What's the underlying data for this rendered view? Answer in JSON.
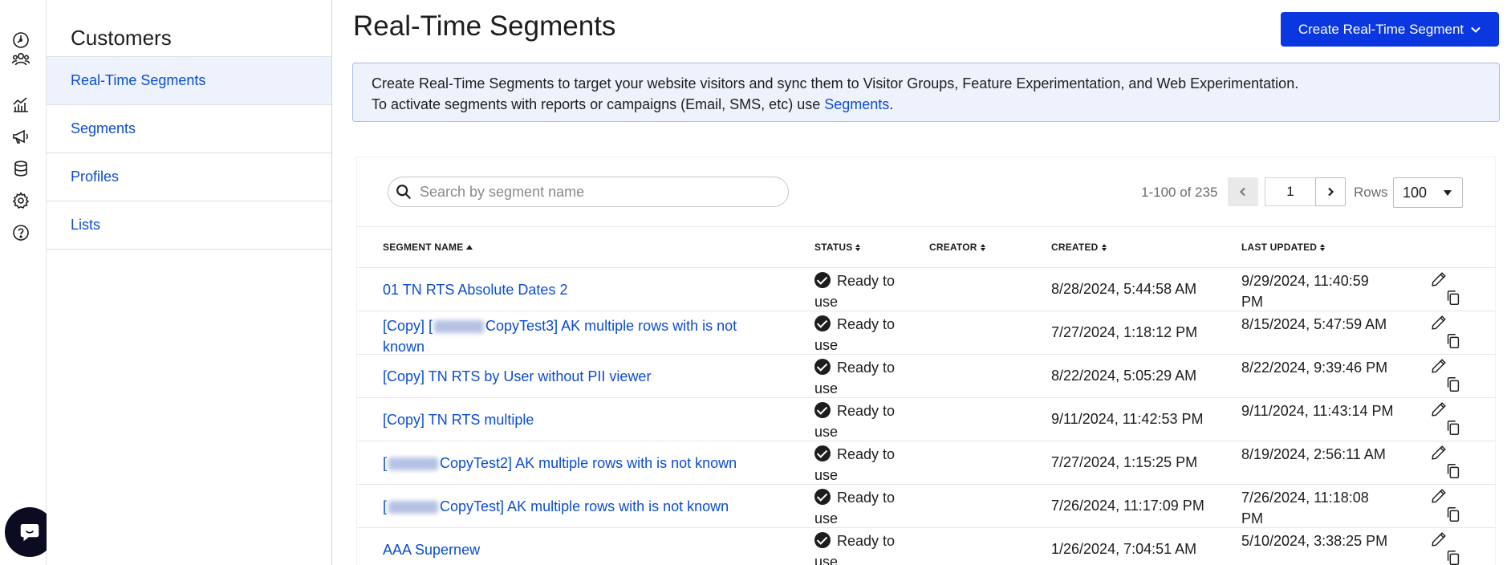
{
  "rail": {
    "icons": [
      "dashboard-icon",
      "customers-icon",
      "analytics-icon",
      "campaigns-icon",
      "data-icon",
      "settings-icon",
      "help-icon"
    ]
  },
  "sidebar": {
    "title": "Customers",
    "items": [
      {
        "label": "Real-Time Segments",
        "active": true
      },
      {
        "label": "Segments",
        "active": false
      },
      {
        "label": "Profiles",
        "active": false
      },
      {
        "label": "Lists",
        "active": false
      }
    ]
  },
  "header": {
    "title": "Real-Time Segments",
    "create_label": "Create Real-Time Segment",
    "accent": "#0a37e0"
  },
  "info": {
    "line1": "Create Real-Time Segments to target your website visitors and sync them to Visitor Groups, Feature Experimentation, and Web Experimentation.",
    "line2_prefix": "To activate segments with reports or campaigns (Email, SMS, etc) use ",
    "line2_link": "Segments",
    "line2_suffix": "."
  },
  "search": {
    "placeholder": "Search by segment name"
  },
  "pagination": {
    "range": "1-100 of 235",
    "page": "1",
    "rows_label": "Rows",
    "rows_value": "100"
  },
  "table": {
    "columns": {
      "name": "SEGMENT NAME",
      "status": "STATUS",
      "creator": "CREATOR",
      "created": "CREATED",
      "updated": "LAST UPDATED"
    },
    "rows": [
      {
        "name_pre": "01 TN RTS Absolute Dates 2",
        "blurred": false,
        "name_post": "",
        "status": "Ready to use",
        "creator": "",
        "created": "8/28/2024, 5:44:58 AM",
        "updated": "9/29/2024, 11:40:59 PM"
      },
      {
        "name_pre": "[Copy] [",
        "blurred": true,
        "name_post": "CopyTest3] AK multiple rows with is not known",
        "status": "Ready to use",
        "creator": "",
        "created": "7/27/2024, 1:18:12 PM",
        "updated": "8/15/2024, 5:47:59 AM"
      },
      {
        "name_pre": "[Copy] TN RTS by User without PII viewer",
        "blurred": false,
        "name_post": "",
        "status": "Ready to use",
        "creator": "",
        "created": "8/22/2024, 5:05:29 AM",
        "updated": "8/22/2024, 9:39:46 PM"
      },
      {
        "name_pre": "[Copy] TN RTS multiple",
        "blurred": false,
        "name_post": "",
        "status": "Ready to use",
        "creator": "",
        "created": "9/11/2024, 11:42:53 PM",
        "updated": "9/11/2024, 11:43:14 PM"
      },
      {
        "name_pre": "[",
        "blurred": true,
        "name_post": "CopyTest2] AK multiple rows with is not known",
        "status": "Ready to use",
        "creator": "",
        "created": "7/27/2024, 1:15:25 PM",
        "updated": "8/19/2024, 2:56:11 AM"
      },
      {
        "name_pre": "[",
        "blurred": true,
        "name_post": "CopyTest] AK multiple rows with is not known",
        "status": "Ready to use",
        "creator": "",
        "created": "7/26/2024, 11:17:09 PM",
        "updated": "7/26/2024, 11:18:08 PM"
      },
      {
        "name_pre": "AAA Supernew",
        "blurred": false,
        "name_post": "",
        "status": "Ready to use",
        "creator": "",
        "created": "1/26/2024, 7:04:51 AM",
        "updated": "5/10/2024, 3:38:25 PM"
      }
    ]
  }
}
